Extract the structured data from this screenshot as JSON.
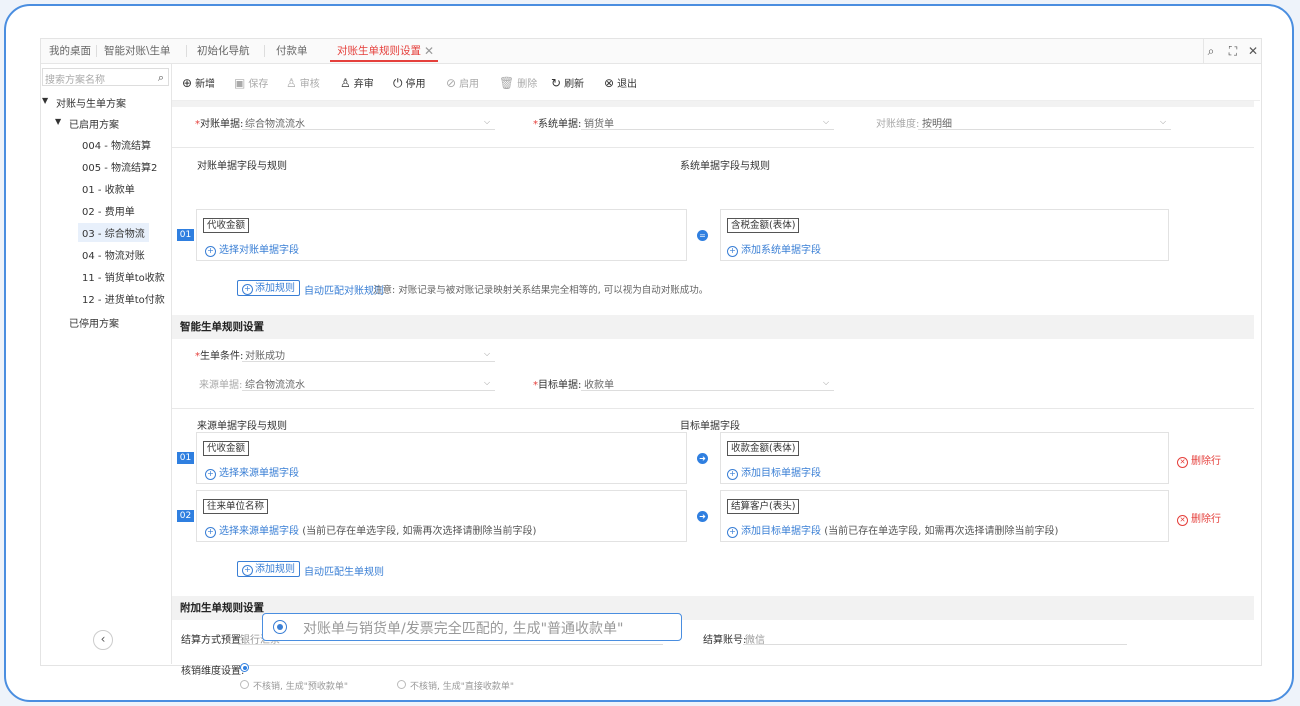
{
  "tabs": [
    {
      "label": "我的桌面"
    },
    {
      "label": "智能对账\\生单"
    },
    {
      "label": "初始化导航"
    },
    {
      "label": "付款单"
    },
    {
      "label": "对账生单规则设置"
    }
  ],
  "sidebar": {
    "search_placeholder": "搜索方案名称",
    "root": "对账与生单方案",
    "enabled_group": "已启用方案",
    "items": [
      {
        "label": "004 - 物流结算"
      },
      {
        "label": "005 - 物流结算2"
      },
      {
        "label": "01 - 收款单"
      },
      {
        "label": "02 - 费用单"
      },
      {
        "label": "03 - 综合物流"
      },
      {
        "label": "04 - 物流对账"
      },
      {
        "label": "11 - 销货单to收款"
      },
      {
        "label": "12 - 进货单to付款"
      }
    ],
    "disabled_group": "已停用方案"
  },
  "toolbar": {
    "new": "新增",
    "save": "保存",
    "audit": "审核",
    "abandon": "弃审",
    "disable": "停用",
    "enable": "启用",
    "delete": "删除",
    "refresh": "刷新",
    "exit": "退出"
  },
  "recon": {
    "recon_doc_label": "对账单据:",
    "recon_doc_value": "综合物流流水",
    "system_doc_label": "系统单据:",
    "system_doc_value": "销货单",
    "dimension_label": "对账维度:",
    "dimension_value": "按明细",
    "left_title": "对账单据字段与规则",
    "right_title": "系统单据字段与规则",
    "row_num": "01",
    "left_tag": "代收金额",
    "left_add": "选择对账单据字段",
    "right_tag": "含税金额(表体)",
    "right_add": "添加系统单据字段",
    "add_rule": "添加规则",
    "auto_match": "自动匹配对账规则",
    "note": "注意: 对账记录与被对账记录映射关系结果完全相等的, 可以视为自动对账成功。"
  },
  "gen": {
    "section_title": "智能生单规则设置",
    "condition_label": "生单条件:",
    "condition_value": "对账成功",
    "source_label": "来源单据:",
    "source_value": "综合物流流水",
    "target_label": "目标单据:",
    "target_value": "收款单",
    "left_title": "来源单据字段与规则",
    "right_title": "目标单据字段",
    "rows": [
      {
        "num": "01",
        "left_tag": "代收金额",
        "left_add": "选择来源单据字段",
        "left_hint": "",
        "right_tag": "收款金额(表体)",
        "right_add": "添加目标单据字段",
        "right_hint": "",
        "delete": "删除行"
      },
      {
        "num": "02",
        "left_tag": "往来单位名称",
        "left_add": "选择来源单据字段",
        "left_hint": "(当前已存在单选字段, 如需再次选择请删除当前字段)",
        "right_tag": "结算客户(表头)",
        "right_add": "添加目标单据字段",
        "right_hint": "(当前已存在单选字段, 如需再次选择请删除当前字段)",
        "delete": "删除行"
      }
    ],
    "add_rule": "添加规则",
    "auto_match": "自动匹配生单规则"
  },
  "extra": {
    "section_title": "附加生单规则设置",
    "settle_label": "结算方式预置:",
    "settle_value": "银行汇票",
    "account_label": "结算账号:",
    "account_value": "微信",
    "verify_label": "核销维度设置:",
    "option2": "不核销, 生成\"预收款单\"",
    "option3": "不核销, 生成\"直接收款单\""
  },
  "callout": {
    "text": "对账单与销货单/发票完全匹配的, 生成\"普通收款单\""
  }
}
